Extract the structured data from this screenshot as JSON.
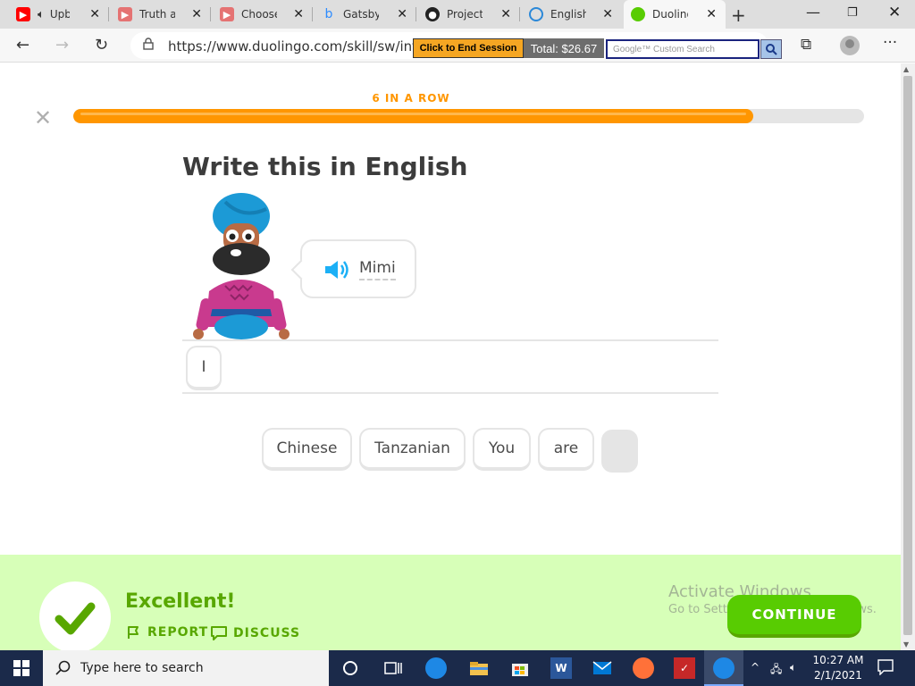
{
  "browser": {
    "tabs": [
      {
        "title": "Upbeat",
        "favicon": "youtube-icon",
        "color": "#ff0000"
      },
      {
        "title": "Truth as t",
        "favicon": "youtube-icon",
        "color": "#ff0000"
      },
      {
        "title": "Choose Y",
        "favicon": "youtube-icon",
        "color": "#ff0000"
      },
      {
        "title": "Gatsby -",
        "favicon": "bing-icon",
        "color": "#2d8cff"
      },
      {
        "title": "Projects",
        "favicon": "github-icon",
        "color": "#222222"
      },
      {
        "title": "English Pl",
        "favicon": "globe-icon",
        "color": "#2b88d8"
      },
      {
        "title": "Duolingo",
        "favicon": "duolingo-icon",
        "color": "#58cc02"
      }
    ],
    "url": "https://www.duolingo.com/skill/sw/intr",
    "end_session_label": "Click to End Session",
    "total_label": "Total: $26.67",
    "google_placeholder": "Google™ Custom Search"
  },
  "lesson": {
    "streak_label": "6 IN A ROW",
    "progress": 0.86,
    "title": "Write this in English",
    "prompt_word": "Mimi",
    "answer_tokens": [
      "I"
    ],
    "word_bank": [
      "Chinese",
      "Tanzanian",
      "You",
      "are",
      ""
    ]
  },
  "feedback": {
    "headline": "Excellent!",
    "report_label": "REPORT",
    "discuss_label": "DISCUSS",
    "continue_label": "CONTINUE"
  },
  "watermark": {
    "line1": "Activate Windows",
    "line2": "Go to Settings to activate Windows."
  },
  "taskbar": {
    "search_placeholder": "Type here to search",
    "time": "10:27 AM",
    "date": "2/1/2021"
  },
  "colors": {
    "accent_orange": "#ff9600",
    "duo_green": "#58cc02",
    "feedback_bg": "#d7ffb8"
  }
}
